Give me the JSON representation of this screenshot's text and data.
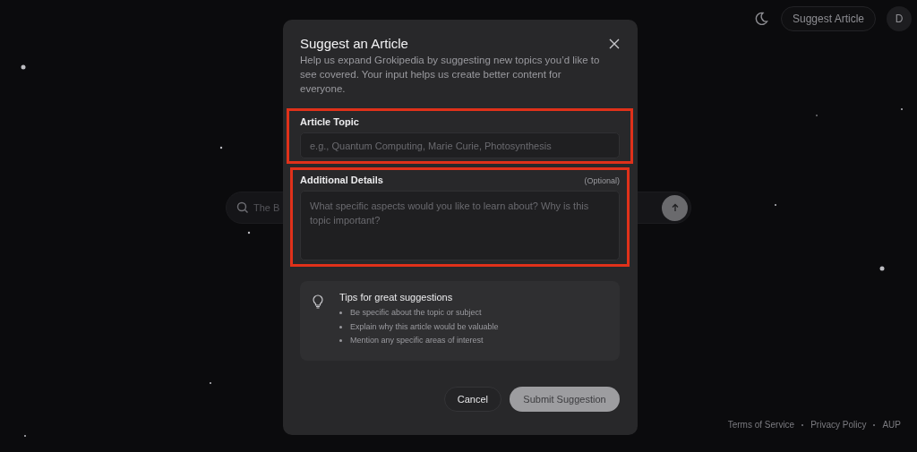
{
  "header": {
    "suggest_button": "Suggest Article",
    "avatar": "D"
  },
  "search": {
    "placeholder": "The B"
  },
  "dialog": {
    "title": "Suggest an Article",
    "description": "Help us expand Grokipedia by suggesting new topics you’d like to see covered. Your input helps us create better content for everyone.",
    "fields": [
      {
        "kind": "input",
        "label": "Article Topic",
        "placeholder": "e.g., Quantum Computing, Marie Curie, Photosynthesis",
        "highlighted": true
      },
      {
        "kind": "textarea",
        "label": "Additional Details",
        "note": "(Optional)",
        "placeholder": "What specific aspects would you like to learn about? Why is this topic important?",
        "highlighted": true
      }
    ],
    "tips": {
      "title": "Tips for great suggestions",
      "items": [
        "Be specific about the topic or subject",
        "Explain why this article would be valuable",
        "Mention any specific areas of interest"
      ]
    },
    "buttons": [
      {
        "kind": "secondary",
        "label": "Cancel"
      },
      {
        "kind": "primary",
        "label": "Submit Suggestion",
        "disabled": true
      }
    ]
  },
  "footer": {
    "links": [
      "Terms of Service",
      "Privacy Policy",
      "AUP"
    ]
  }
}
